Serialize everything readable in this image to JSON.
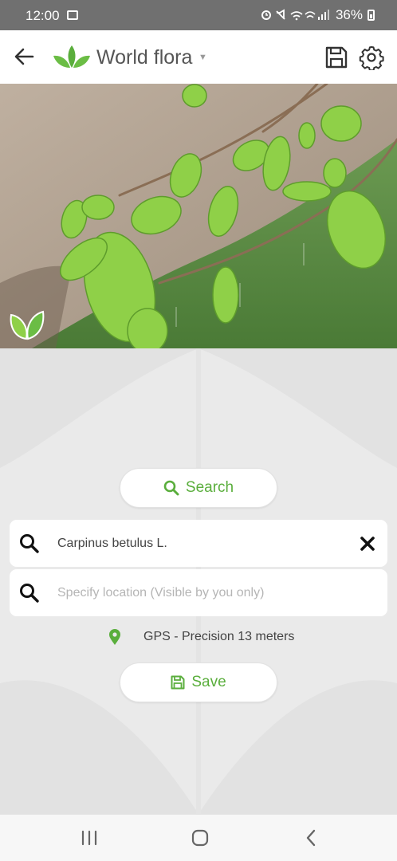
{
  "status_bar": {
    "time": "12:00",
    "battery": "36%",
    "icons": [
      "gallery-icon",
      "alarm-icon",
      "mute-icon",
      "wifi-icon",
      "wifi-call-icon",
      "signal-icon",
      "battery-icon"
    ]
  },
  "app_bar": {
    "title": "World flora",
    "icons": [
      "back-arrow-icon",
      "leaf-logo-icon",
      "dropdown-caret-icon",
      "save-icon",
      "settings-gear-icon"
    ]
  },
  "search_button": {
    "label": "Search",
    "icon": "search-icon"
  },
  "species_field": {
    "value": "Carpinus betulus L.",
    "icon": "search-icon",
    "clear_icon": "close-icon"
  },
  "location_field": {
    "placeholder": "Specify location (Visible by you only)",
    "icon": "search-icon"
  },
  "gps": {
    "text": "GPS - Precision 13 meters",
    "icon": "location-pin-icon"
  },
  "save_button": {
    "label": "Save",
    "icon": "floppy-disk-icon"
  },
  "nav_bar": {
    "icons": [
      "recent-apps-icon",
      "home-icon",
      "back-icon"
    ]
  },
  "colors": {
    "accent": "#5aae3c",
    "status_bar": "#707070",
    "text": "#444444"
  }
}
